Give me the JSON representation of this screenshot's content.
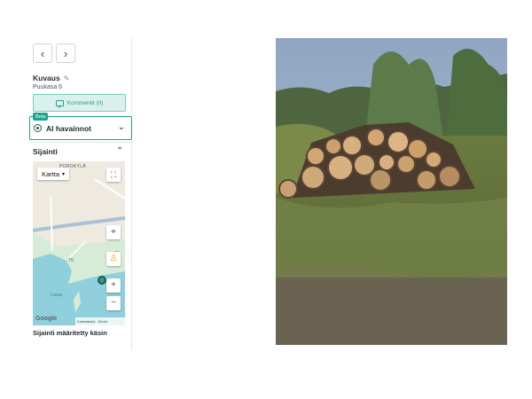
{
  "nav": {
    "prev_icon": "chevron-left-icon",
    "next_icon": "chevron-right-icon"
  },
  "header": {
    "title": "Kuvaus",
    "subtitle": "Puukasa 6"
  },
  "comments": {
    "label": "Kommentit (0)"
  },
  "ai": {
    "badge": "Beta",
    "label": "AI havainnot"
  },
  "location": {
    "title": "Sijainti",
    "map": {
      "type_select": "Kartta",
      "place_labels": [
        "POROKYLÄ",
        "Liesa"
      ],
      "road_numbers": [
        "75",
        "75"
      ],
      "attribution": "Google",
      "footer_links": [
        "Karttatiedot",
        "Ehdot"
      ]
    },
    "status": "Sijainti määritetty käsin"
  },
  "colors": {
    "accent": "#20a38e",
    "accent_light": "#d9f0ec",
    "water": "#8fd0dc",
    "road": "#a9c1d6"
  }
}
